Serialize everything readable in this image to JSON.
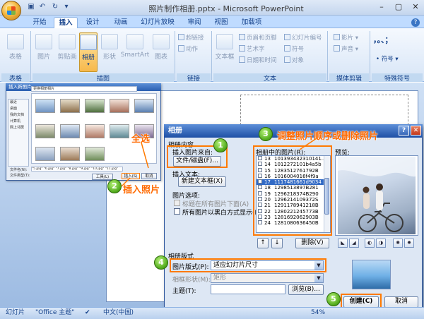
{
  "window": {
    "title": "照片制作相册.pptx - Microsoft PowerPoint"
  },
  "tabs": [
    "开始",
    "插入",
    "设计",
    "动画",
    "幻灯片放映",
    "审阅",
    "视图",
    "加载项"
  ],
  "ribbon": {
    "groups": {
      "tables": "表格",
      "illustrations": "插图",
      "links": "链接",
      "text": "文本",
      "media": "媒体剪辑",
      "symbols": "特殊符号"
    },
    "buttons": {
      "table": "表格",
      "picture": "图片",
      "clipart": "剪贴画",
      "album": "相册",
      "shapes": "形状",
      "smartart": "SmartArt",
      "chart": "图表",
      "hyperlink": "超链接",
      "action": "动作",
      "textbox": "文本框",
      "header_footer": "页眉和页脚",
      "wordart": "艺术字",
      "datetime": "日期和时间",
      "slide_number": "幻灯片编号",
      "symbol": "符号",
      "object": "对象",
      "movie": "影片",
      "sound": "声音",
      "symbol_menu": "符号"
    }
  },
  "file_dialog": {
    "title": "插入新图片",
    "address": "更换相册相片",
    "places": [
      "最近",
      "桌面",
      "我的文档",
      "计算机",
      "网上邻居"
    ],
    "filename_label": "文件名(N):",
    "filename_value": "\"5.jpg\" \"6.jpg\" \"7.jpg\" \"8.jpg\" \"9.jpg\" \"10.jpg\" \"11.jpg\"",
    "filetype_label": "文件类型(T):",
    "tools_btn": "工具(L)",
    "insert_btn": "插入(S)",
    "cancel_btn": "取消"
  },
  "album": {
    "title": "相册",
    "content_section": "相册内容",
    "insert_from": "插入图片来自:",
    "file_disk_btn": "文件/磁盘(F)...",
    "insert_text": "插入文本:",
    "new_textbox_btn": "新建文本框(X)",
    "picture_options": "图片选项:",
    "caption_below": "标题在所有图片下面(A)",
    "all_bw": "所有图片以黑白方式显示(K)",
    "pictures_in_album": "相册中的图片(R):",
    "preview": "预览:",
    "delete_btn": "删除(V)",
    "pictures": [
      {
        "n": "13",
        "name": "101393432310141..."
      },
      {
        "n": "14",
        "name": "1012272101b4a5b"
      },
      {
        "n": "15",
        "name": "1283512761792B"
      },
      {
        "n": "16",
        "name": "1016004016f4f9a"
      },
      {
        "n": "17",
        "name": "1117481661d9034"
      },
      {
        "n": "18",
        "name": "1298513897B281"
      },
      {
        "n": "19",
        "name": "1296218374B290"
      },
      {
        "n": "20",
        "name": "1296214109372S"
      },
      {
        "n": "21",
        "name": "1291178941218B"
      },
      {
        "n": "22",
        "name": "1280221245773B"
      },
      {
        "n": "23",
        "name": "1281692062903B"
      },
      {
        "n": "24",
        "name": "1281080636450B"
      }
    ],
    "selected_index": 4,
    "layout_section": "相册版式",
    "picture_layout_label": "图片版式(P):",
    "picture_layout_value": "适应幻灯片尺寸",
    "frame_shape_label": "相框形状(M):",
    "frame_shape_value": "矩形",
    "theme_label": "主题(T):",
    "browse_btn": "浏览(B)...",
    "create_btn": "创建(C)",
    "cancel_btn": "取消"
  },
  "annotations": {
    "select_all": "全选",
    "insert_photos": "插入照片",
    "reorder": "调整照片顺序或删除照片",
    "steps": [
      "1",
      "2",
      "3",
      "4",
      "5"
    ]
  },
  "status": {
    "slide": "幻灯片",
    "theme": "\"Office 主题\"",
    "language": "中文(中国)",
    "zoom": "54%"
  }
}
